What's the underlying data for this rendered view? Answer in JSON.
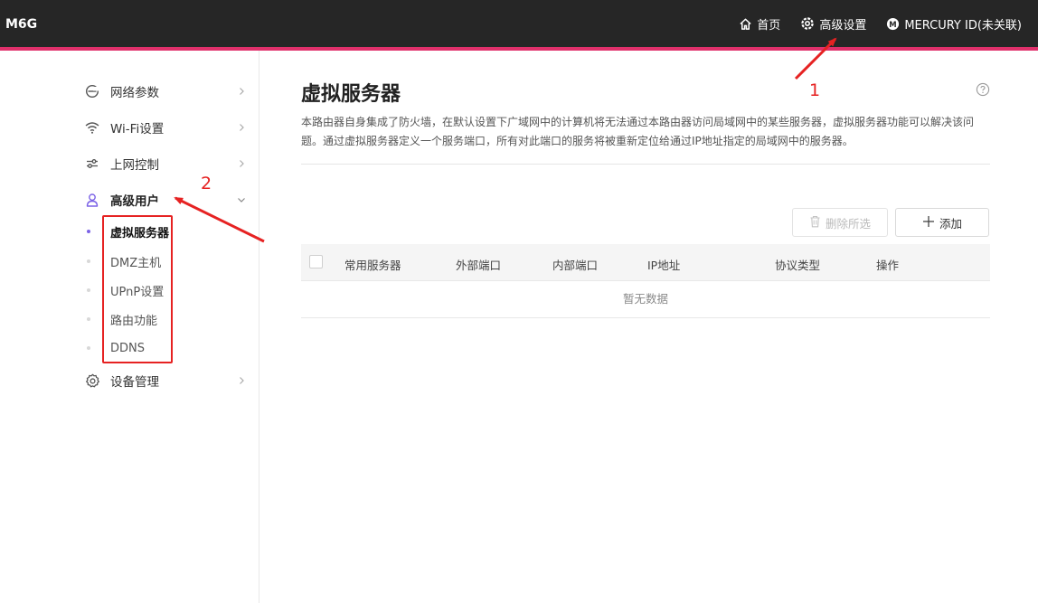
{
  "header": {
    "brand": "M6G",
    "nav": [
      {
        "label": "首页",
        "icon": "home-icon"
      },
      {
        "label": "高级设置",
        "icon": "gear-icon"
      },
      {
        "label": "MERCURY ID(未关联)",
        "icon": "mercury-logo-icon"
      }
    ],
    "accent_color": "#e0306b"
  },
  "sidebar": {
    "items": [
      {
        "label": "网络参数",
        "icon": "network-icon"
      },
      {
        "label": "Wi-Fi设置",
        "icon": "wifi-icon"
      },
      {
        "label": "上网控制",
        "icon": "sliders-icon"
      },
      {
        "label": "高级用户",
        "icon": "user-icon"
      },
      {
        "label": "设备管理",
        "icon": "gear-icon"
      }
    ],
    "sub_items": [
      {
        "label": "虚拟服务器",
        "active": true
      },
      {
        "label": "DMZ主机"
      },
      {
        "label": "UPnP设置"
      },
      {
        "label": "路由功能"
      },
      {
        "label": "DDNS"
      }
    ],
    "active_color": "#7b62e6"
  },
  "main": {
    "title": "虚拟服务器",
    "description": "本路由器自身集成了防火墙，在默认设置下广域网中的计算机将无法通过本路由器访问局域网中的某些服务器，虚拟服务器功能可以解决该问题。通过虚拟服务器定义一个服务端口，所有对此端口的服务将被重新定位给通过IP地址指定的局域网中的服务器。",
    "buttons": {
      "delete_label": "删除所选",
      "add_label": "添加"
    },
    "table": {
      "columns": [
        "常用服务器",
        "外部端口",
        "内部端口",
        "IP地址",
        "协议类型",
        "操作"
      ],
      "empty_text": "暂无数据"
    }
  },
  "annotations": {
    "label_1": "1",
    "label_2": "2",
    "color": "#e62222"
  }
}
